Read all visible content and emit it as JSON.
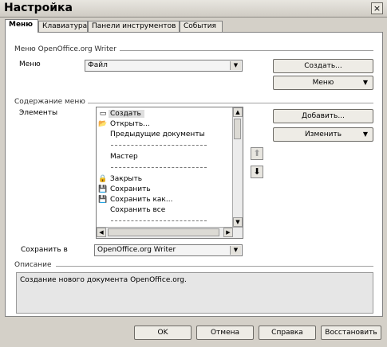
{
  "window": {
    "title": "Настройка",
    "close": "×"
  },
  "tabs": [
    {
      "label": "Меню"
    },
    {
      "label": "Клавиатура"
    },
    {
      "label": "Панели инструментов"
    },
    {
      "label": "События"
    }
  ],
  "menu_section": {
    "title": "Меню OpenOffice.org Writer",
    "menu_label": "Меню",
    "menu_value": "Файл",
    "new_button": "Создать...",
    "menu_button": "Меню"
  },
  "content_section": {
    "title": "Содержание меню",
    "entries_label": "Элементы",
    "items": [
      {
        "icon": "▭",
        "label": "Создать"
      },
      {
        "icon": "📂",
        "label": "Открыть..."
      },
      {
        "icon": "",
        "label": "Предыдущие документы"
      },
      {
        "icon": "",
        "label": "Мастер"
      },
      {
        "icon": "🔒",
        "label": "Закрыть"
      },
      {
        "icon": "💾",
        "label": "Сохранить"
      },
      {
        "icon": "💾",
        "label": "Сохранить как..."
      },
      {
        "icon": "",
        "label": "Сохранить все"
      }
    ],
    "add_button": "Добавить...",
    "modify_button": "Изменить",
    "save_in_label": "Сохранить в",
    "save_in_value": "OpenOffice.org Writer"
  },
  "description": {
    "title": "Описание",
    "text": "Создание нового документа OpenOffice.org."
  },
  "footer": {
    "ok": "OK",
    "cancel": "Отмена",
    "help": "Справка",
    "reset": "Восстановить"
  }
}
